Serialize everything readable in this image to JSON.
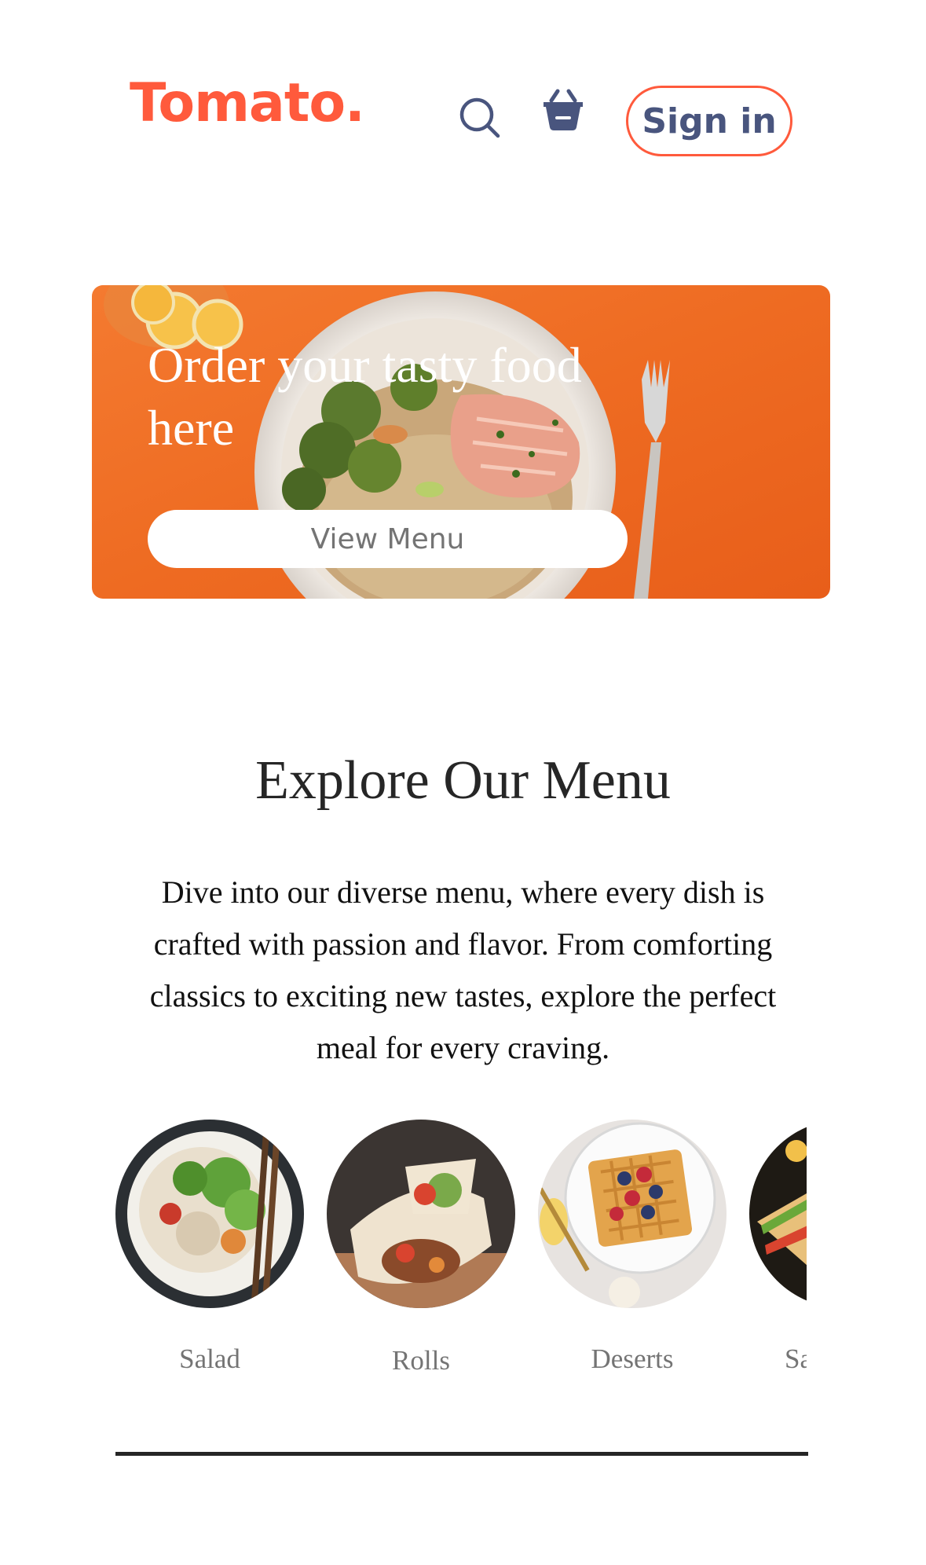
{
  "colors": {
    "brand": "#ff5a3c",
    "nav_text": "#49557e",
    "hero_orange": "#f06a24",
    "heading": "#262626",
    "muted": "#747474"
  },
  "navbar": {
    "logo": "Tomato.",
    "search_icon": "search-icon",
    "basket_icon": "basket-icon",
    "signin_label": "Sign in"
  },
  "hero": {
    "title": "Order your tasty food here",
    "button_label": "View Menu"
  },
  "explore": {
    "title": "Explore Our Menu",
    "description": "Dive into our diverse menu, where every dish is crafted with passion and flavor. From comforting classics to exciting new tastes, explore the perfect meal for every craving.",
    "items": [
      {
        "label": "Salad"
      },
      {
        "label": "Rolls"
      },
      {
        "label": "Deserts"
      },
      {
        "label": "Sa"
      }
    ]
  }
}
